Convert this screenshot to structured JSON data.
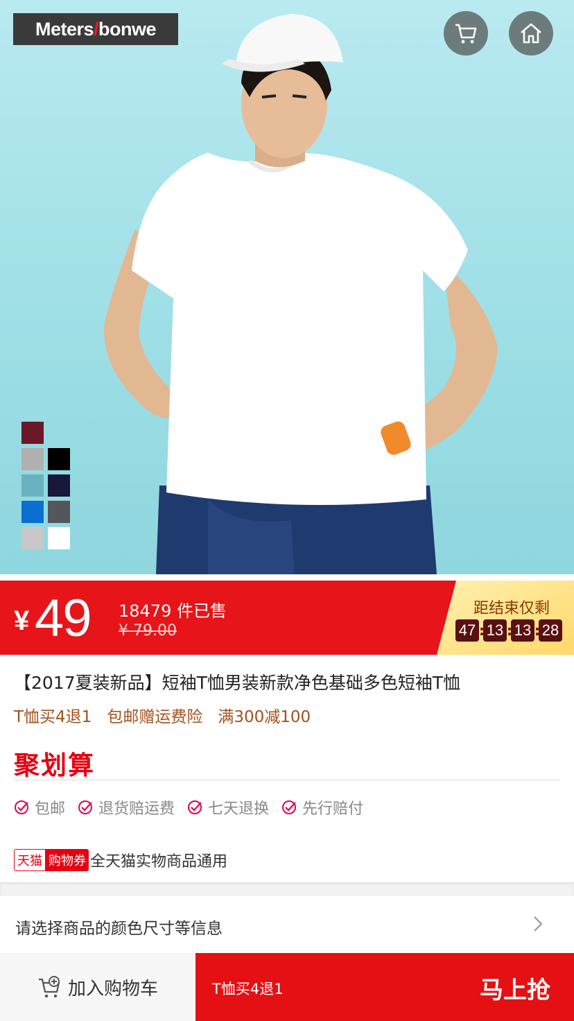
{
  "brand": {
    "logo_left": "Meters",
    "logo_slash": "/",
    "logo_right": "bonwe"
  },
  "header": {
    "cart_icon": "cart-icon",
    "home_icon": "home-icon"
  },
  "product_image": {
    "color_swatches": [
      "#6b1828",
      "#b0b0b0",
      "#000000",
      "#6bb2c0",
      "#17183a",
      "#0a6fd0",
      "#55555c",
      "#c8c8c8",
      "#ffffff"
    ]
  },
  "price": {
    "currency": "¥",
    "current": "49",
    "sold": "18479 件已售",
    "original": "¥ 79.00"
  },
  "countdown": {
    "label": "距结束仅剩",
    "hours": "47",
    "minutes": "13",
    "seconds": "13",
    "ms": "28"
  },
  "product": {
    "title": "【2017夏装新品】短袖T恤男装新款净色基础多色短袖T恤",
    "promos": [
      "T恤买4退1",
      "包邮赠运费险",
      "满300减100"
    ]
  },
  "juhuasuan": "聚划算",
  "guarantees": [
    "包邮",
    "退货赔运费",
    "七天退换",
    "先行赔付"
  ],
  "coupon": {
    "tag1": "天猫",
    "tag2": "购物券",
    "text": "全天猫实物商品通用"
  },
  "sku_selector": {
    "text": "请选择商品的颜色尺寸等信息"
  },
  "bottom": {
    "add_to_cart": "加入购物车",
    "buy_promo": "T恤买4退1",
    "buy_now": "马上抢"
  },
  "colors": {
    "accent": "#e71419",
    "promo_text": "#a0511c",
    "countdown_bg": "#ffe38a"
  }
}
